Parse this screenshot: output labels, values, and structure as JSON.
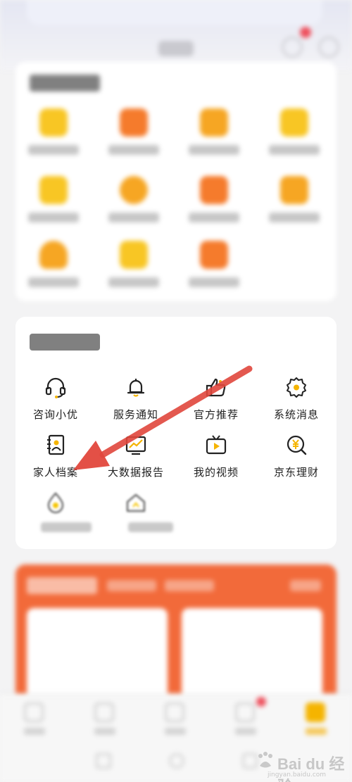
{
  "more_tools": {
    "items": [
      {
        "label": "咨询小优",
        "icon": "headset-icon"
      },
      {
        "label": "服务通知",
        "icon": "bell-icon"
      },
      {
        "label": "官方推荐",
        "icon": "thumbs-up-icon"
      },
      {
        "label": "系统消息",
        "icon": "gear-icon"
      },
      {
        "label": "家人档案",
        "icon": "family-file-icon"
      },
      {
        "label": "大数据报告",
        "icon": "data-report-icon"
      },
      {
        "label": "我的视频",
        "icon": "video-icon"
      },
      {
        "label": "京东理财",
        "icon": "finance-icon"
      }
    ]
  },
  "watermark": {
    "brand": "Bai du 经验",
    "domain": "jingyan.baidu.com"
  },
  "colors": {
    "accent": "#f5b400",
    "arrow": "#e1473c",
    "promo": "#f26a3a",
    "badge": "#ee4f5c"
  }
}
